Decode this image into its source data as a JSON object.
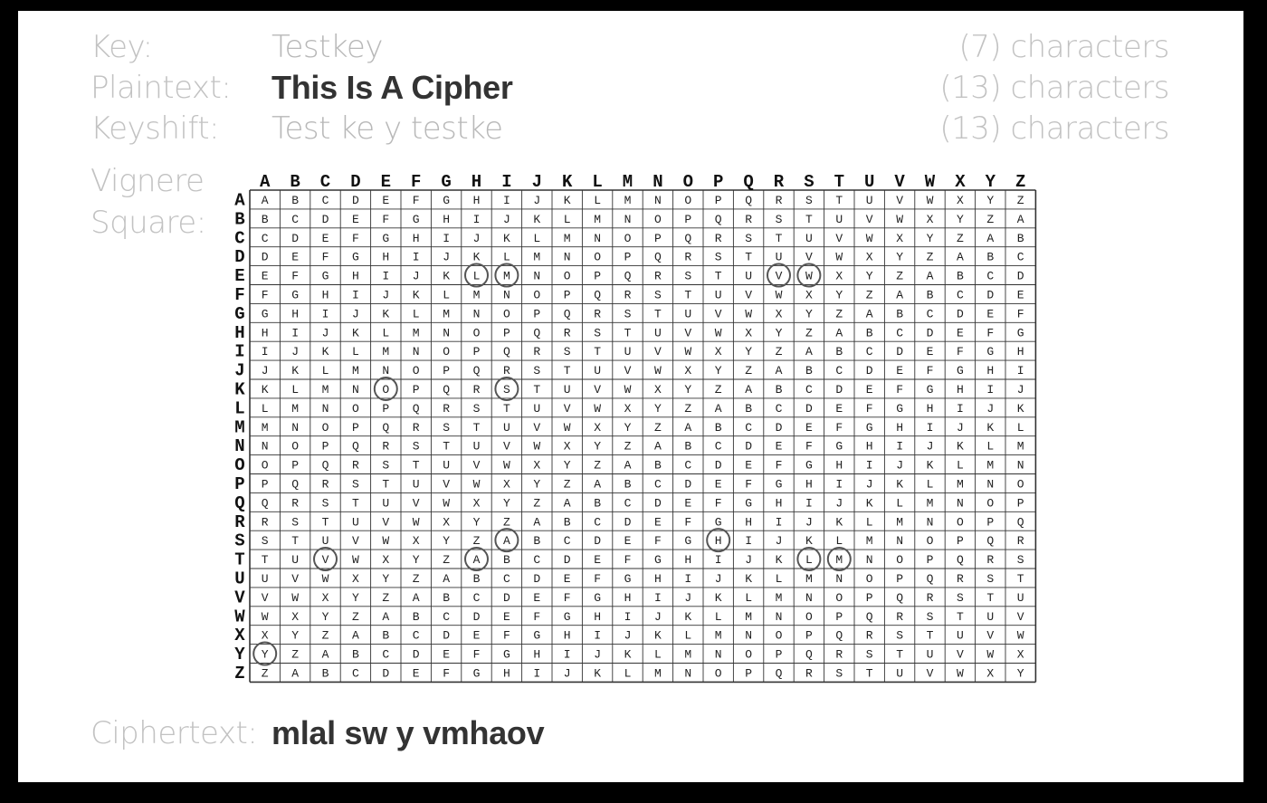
{
  "fields": {
    "key_label": "Key:",
    "key_value": "Testkey",
    "key_count": "(7) characters",
    "plaintext_label": "Plaintext:",
    "plaintext_value": "This Is A Cipher",
    "plaintext_count": "(13) characters",
    "keyshift_label": "Keyshift:",
    "keyshift_value": "Test ke y testke",
    "keyshift_count": "(13) characters",
    "square_label_line1": "Vignere",
    "square_label_line2": "Square:",
    "ciphertext_label": "Ciphertext:",
    "ciphertext_value": "mlal sw y vmhaov"
  },
  "square": {
    "alphabet": "ABCDEFGHIJKLMNOPQRSTUVWXYZ",
    "circled_cells": [
      {
        "row": "E",
        "col": "H"
      },
      {
        "row": "E",
        "col": "I"
      },
      {
        "row": "E",
        "col": "R"
      },
      {
        "row": "E",
        "col": "S"
      },
      {
        "row": "K",
        "col": "E"
      },
      {
        "row": "K",
        "col": "I"
      },
      {
        "row": "S",
        "col": "I"
      },
      {
        "row": "S",
        "col": "P"
      },
      {
        "row": "T",
        "col": "C"
      },
      {
        "row": "T",
        "col": "H"
      },
      {
        "row": "T",
        "col": "S"
      },
      {
        "row": "T",
        "col": "T"
      },
      {
        "row": "Y",
        "col": "A"
      }
    ]
  }
}
